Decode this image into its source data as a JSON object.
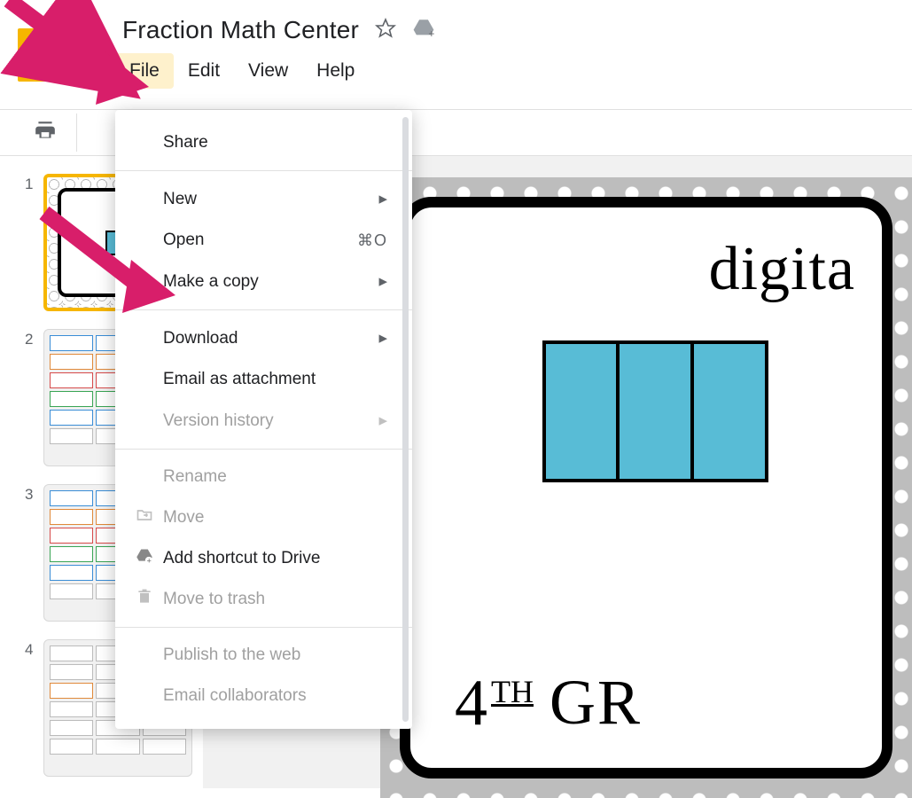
{
  "header": {
    "title": "Fraction Math Center"
  },
  "menubar": {
    "items": [
      {
        "label": "File",
        "active": true
      },
      {
        "label": "Edit"
      },
      {
        "label": "View"
      },
      {
        "label": "Help"
      }
    ]
  },
  "filmstrip": {
    "slides": [
      {
        "num": "1"
      },
      {
        "num": "2"
      },
      {
        "num": "3"
      },
      {
        "num": "4"
      }
    ]
  },
  "dropdown": {
    "share": "Share",
    "new": "New",
    "open": "Open",
    "open_shortcut": "⌘O",
    "makecopy": "Make a copy",
    "download": "Download",
    "emailattach": "Email as attachment",
    "versionhist": "Version history",
    "rename": "Rename",
    "move": "Move",
    "addshortcut": "Add shortcut to Drive",
    "movetrash": "Move to trash",
    "publish": "Publish to the web",
    "emailcollab": "Email collaborators"
  },
  "slide": {
    "title_text": "digita",
    "grade_num": "4",
    "grade_th": "TH",
    "grade_gr": "GR"
  }
}
